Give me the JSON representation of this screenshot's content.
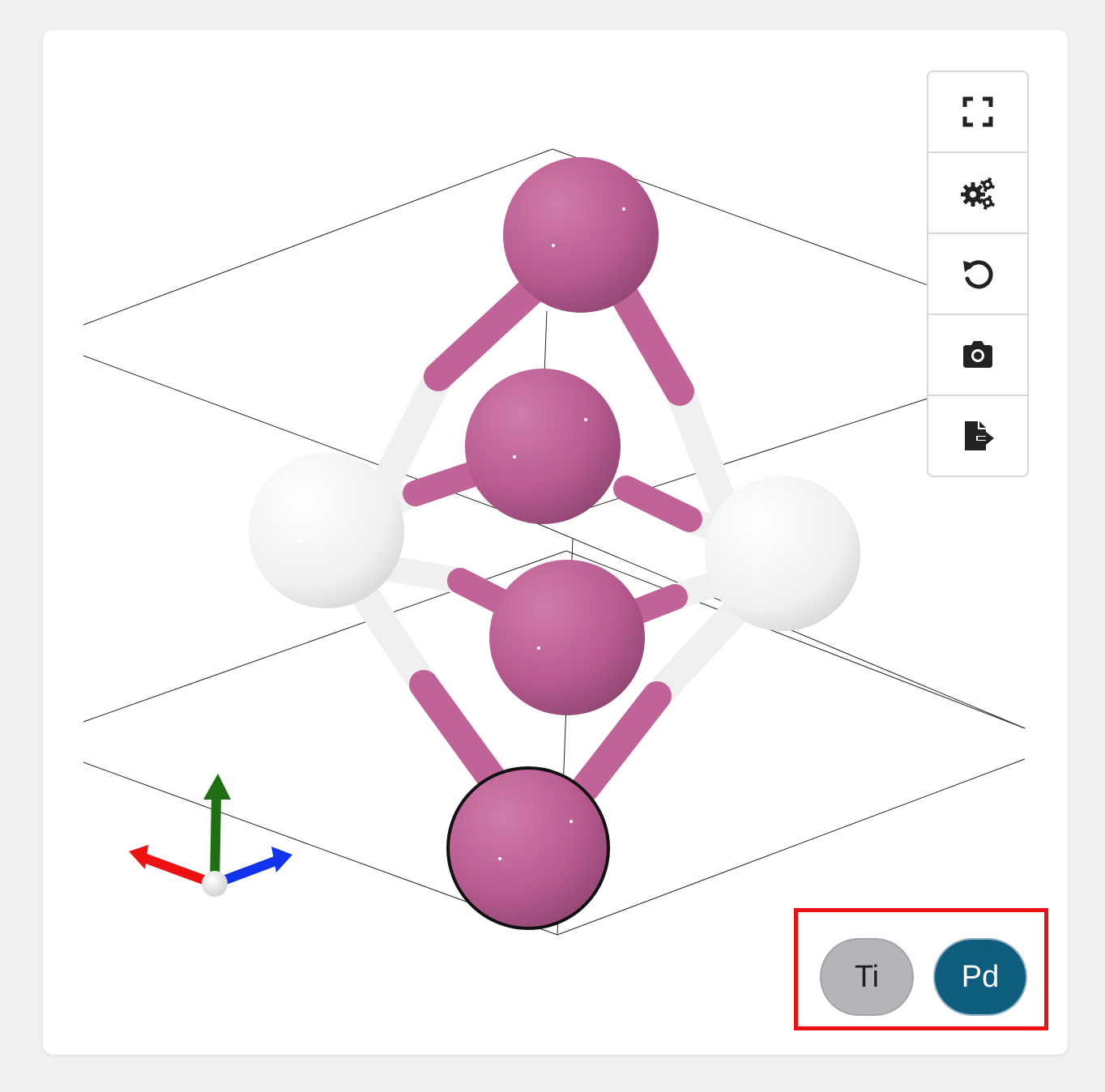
{
  "toolbar": {
    "buttons": [
      {
        "id": "fullscreen",
        "icon": "fullscreen-icon"
      },
      {
        "id": "settings",
        "icon": "gears-icon"
      },
      {
        "id": "reset-view",
        "icon": "rotate-left-icon"
      },
      {
        "id": "screenshot",
        "icon": "camera-icon"
      },
      {
        "id": "export",
        "icon": "file-export-icon"
      }
    ]
  },
  "legend": {
    "elements": [
      {
        "symbol": "Ti",
        "color": "#b4b4b9"
      },
      {
        "symbol": "Pd",
        "color": "#0e5c7e"
      }
    ]
  },
  "structure": {
    "atom_colors": {
      "Pd": "#c06499",
      "Ti": "#f4f4f4"
    },
    "axis_colors": {
      "x": "#ee1111",
      "y": "#1e6e12",
      "z": "#1133ee"
    }
  }
}
